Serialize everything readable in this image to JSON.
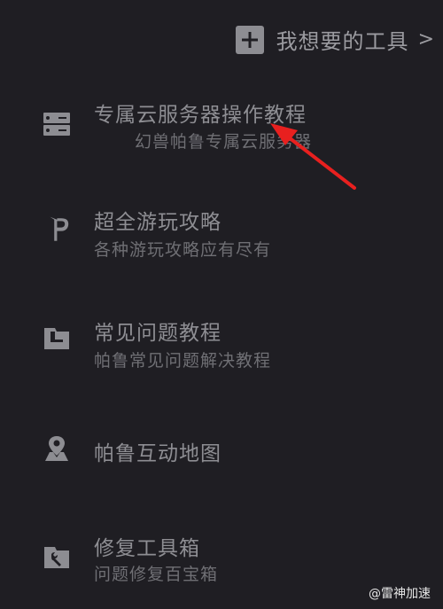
{
  "header": {
    "action_label": "我想要的工具",
    "chevron": ">",
    "icon": "plus-square-icon"
  },
  "menu": [
    {
      "title": "专属云服务器操作教程",
      "subtitle": "幻兽帕鲁专属云服务器",
      "icon": "server-icon"
    },
    {
      "title": "超全游玩攻略",
      "subtitle": "各种游玩攻略应有尽有",
      "icon": "game-logo-icon"
    },
    {
      "title": "常见问题教程",
      "subtitle": "帕鲁常见问题解决教程",
      "icon": "folder-icon"
    },
    {
      "title": "帕鲁互动地图",
      "subtitle": "",
      "icon": "map-pin-icon"
    },
    {
      "title": "修复工具箱",
      "subtitle": "问题修复百宝箱",
      "icon": "wrench-folder-icon"
    }
  ],
  "annotation": {
    "color": "#e8201f"
  },
  "watermark": {
    "text": "@雷神加速"
  }
}
